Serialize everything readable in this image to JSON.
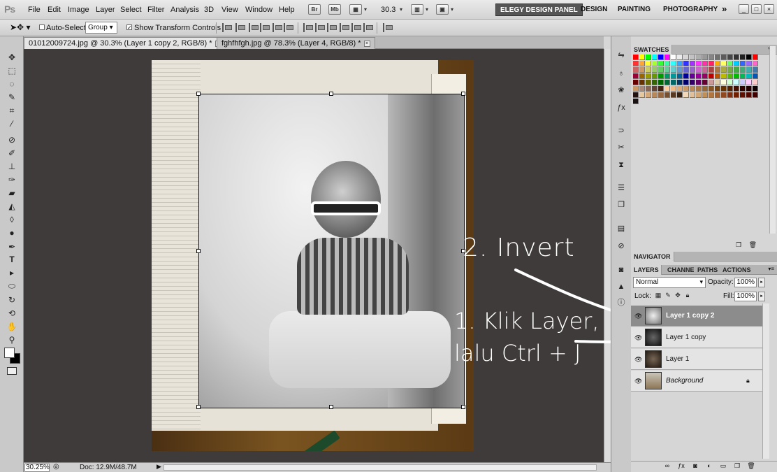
{
  "app": {
    "logo": "Ps"
  },
  "menu": [
    "File",
    "Edit",
    "Image",
    "Layer",
    "Select",
    "Filter",
    "Analysis",
    "3D",
    "View",
    "Window",
    "Help"
  ],
  "menubar_icons": [
    "Br",
    "Mb"
  ],
  "zoom_level": "30.3",
  "workspaces": [
    "ELEGY DESIGN PANEL",
    "DESIGN",
    "PAINTING",
    "PHOTOGRAPHY"
  ],
  "workspaces_more": "»",
  "window_controls": [
    "_",
    "□",
    "×"
  ],
  "options_bar": {
    "auto_select_label": "Auto-Select:",
    "auto_select_value": "Group",
    "transform_label": "Show Transform Controls"
  },
  "documents": [
    {
      "title": "01012009724.jpg @ 30.3% (Layer 1 copy 2, RGB/8) *",
      "active": true
    },
    {
      "title": "fghfhfgh.jpg @ 78.3% (Layer 4, RGB/8) *",
      "active": false
    }
  ],
  "status": {
    "zoom": "30.25%",
    "doc": "Doc: 12.9M/48.7M"
  },
  "annotations": {
    "step2": "2. Invert",
    "step1_line1": "1. Klik Layer,",
    "step1_line2": "lalu Ctrl + J"
  },
  "panels": {
    "swatches_tab": "SWATCHES",
    "navigator_tab": "NAVIGATOR",
    "layers_tabs": [
      "LAYERS",
      "CHANNE",
      "PATHS",
      "ACTIONS"
    ]
  },
  "layers": {
    "blend_mode": "Normal",
    "opacity_label": "Opacity:",
    "opacity": "100%",
    "lock_label": "Lock:",
    "fill_label": "Fill:",
    "fill": "100%",
    "items": [
      {
        "name": "Layer 1 copy 2",
        "selected": true
      },
      {
        "name": "Layer 1 copy",
        "selected": false
      },
      {
        "name": "Layer 1",
        "selected": false
      },
      {
        "name": "Background",
        "selected": false,
        "locked": true
      }
    ]
  },
  "swatch_colors": {
    "accent_workspace": "#555555",
    "selected_layer": "#8c8c8c",
    "canvas_bg": "#3f3b3a"
  }
}
